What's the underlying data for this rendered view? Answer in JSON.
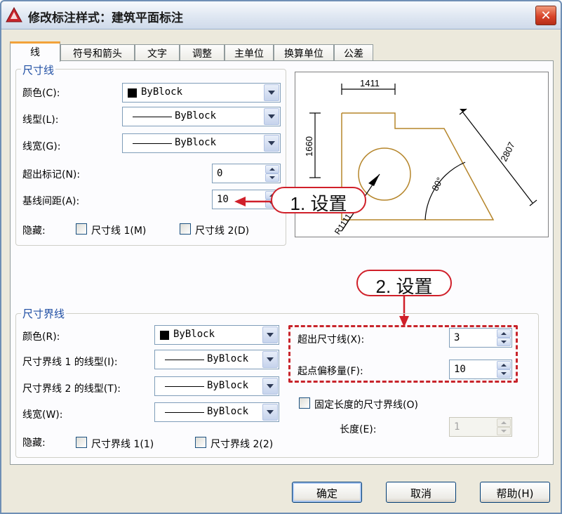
{
  "window": {
    "title": "修改标注样式：建筑平面标注",
    "close_label": "✕"
  },
  "tabs": [
    {
      "label": "线",
      "active": true
    },
    {
      "label": "符号和箭头",
      "active": false
    },
    {
      "label": "文字",
      "active": false
    },
    {
      "label": "调整",
      "active": false
    },
    {
      "label": "主单位",
      "active": false
    },
    {
      "label": "换算单位",
      "active": false
    },
    {
      "label": "公差",
      "active": false
    }
  ],
  "dim_lines": {
    "group_title": "尺寸线",
    "color_label": "颜色(C):",
    "color_value": "ByBlock",
    "linetype_label": "线型(L):",
    "linetype_value": "ByBlock",
    "lineweight_label": "线宽(G):",
    "lineweight_value": "ByBlock",
    "extend_label": "超出标记(N):",
    "extend_value": "0",
    "baseline_label": "基线间距(A):",
    "baseline_value": "10",
    "suppress_label": "隐藏:",
    "suppress_1": "尺寸线 1(M)",
    "suppress_2": "尺寸线 2(D)"
  },
  "ext_lines": {
    "group_title": "尺寸界线",
    "color_label": "颜色(R):",
    "color_value": "ByBlock",
    "linetype1_label": "尺寸界线 1 的线型(I):",
    "linetype1_value": "ByBlock",
    "linetype2_label": "尺寸界线 2 的线型(T):",
    "linetype2_value": "ByBlock",
    "lineweight_label": "线宽(W):",
    "lineweight_value": "ByBlock",
    "suppress_label": "隐藏:",
    "suppress_1": "尺寸界线 1(1)",
    "suppress_2": "尺寸界线 2(2)",
    "extend_label": "超出尺寸线(X):",
    "extend_value": "3",
    "offset_label": "起点偏移量(F):",
    "offset_value": "10",
    "fixed_label": "固定长度的尺寸界线(O)",
    "length_label": "长度(E):",
    "length_value": "1"
  },
  "preview": {
    "dim_top": "1411",
    "dim_left": "1660",
    "dim_diag": "2807",
    "dim_angle": "80°",
    "dim_radius": "R1111"
  },
  "callouts": {
    "step1": "1. 设置",
    "step2": "2. 设置"
  },
  "buttons": {
    "ok": "确定",
    "cancel": "取消",
    "help": "帮助(H)"
  },
  "colors": {
    "callout_red": "#d0202a",
    "group_title_blue": "#1f4ea3",
    "preview_shape": "#b5852a"
  }
}
